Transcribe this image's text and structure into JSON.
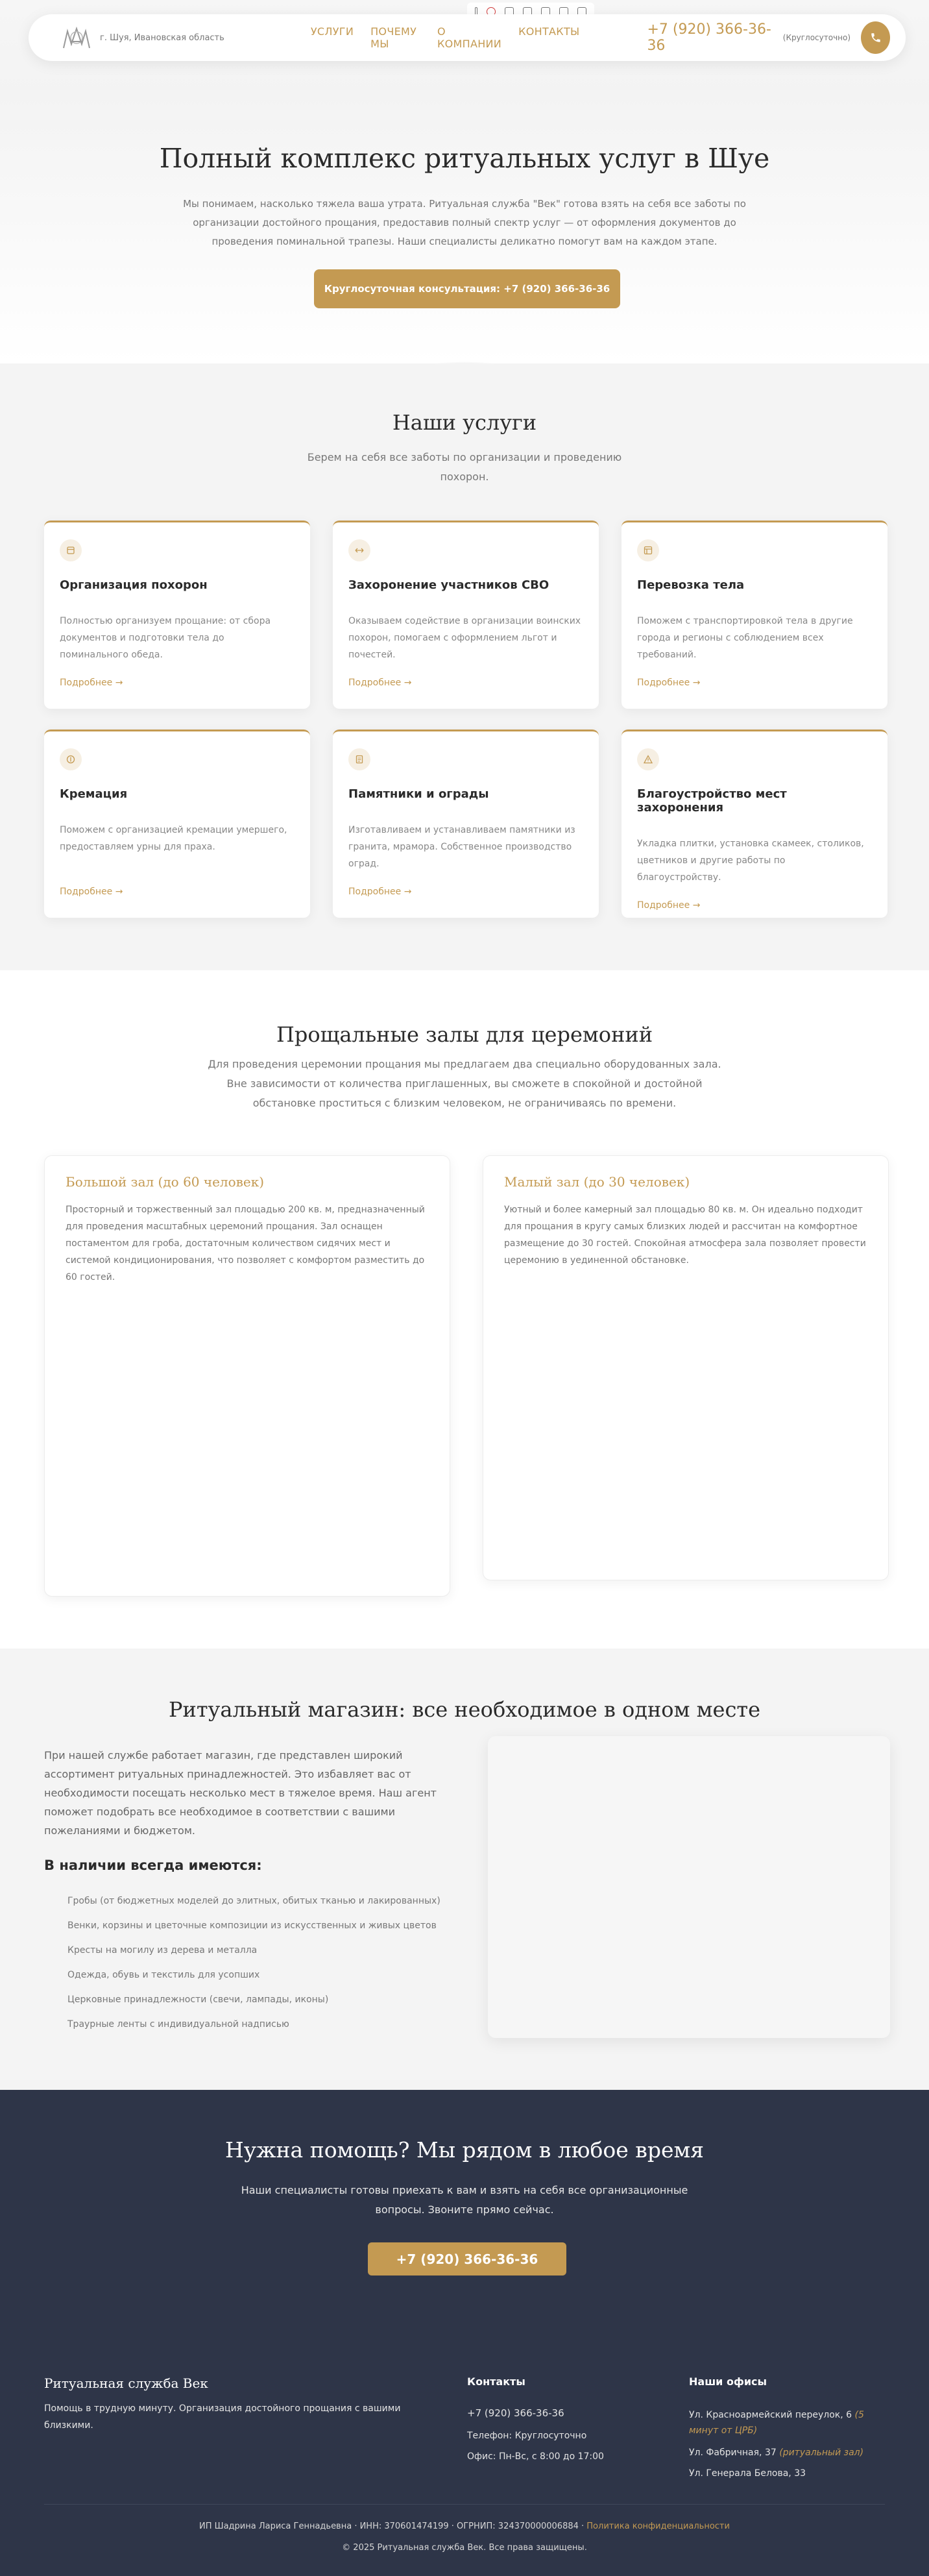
{
  "header": {
    "city": "г. Шуя, Ивановская область",
    "nav": [
      "УСЛУГИ",
      "ПОЧЕМУ МЫ",
      "О КОМПАНИИ",
      "КОНТАКТЫ"
    ],
    "phone": "+7 (920) 366-36-36",
    "phone_note": "(Круглосуточно)",
    "accent_color": "#c49a52"
  },
  "hero": {
    "title": "Полный комплекс ритуальных услуг в Шуе",
    "text": "Мы понимаем, насколько тяжела ваша утрата. Ритуальная служба \"Век\" готова взять на себя все заботы по организации достойного прощания, предоставив полный спектр услуг — от оформления документов до проведения поминальной трапезы. Наши специалисты деликатно помогут вам на каждом этапе.",
    "button": "Круглосуточная консультация: +7 (920) 366-36-36"
  },
  "services": {
    "title": "Наши услуги",
    "subtitle": "Берем на себя все заботы по организации и проведению похорон.",
    "more_label": "Подробнее →",
    "items": [
      {
        "title": "Организация похорон",
        "text": "Полностью организуем прощание: от сбора документов и подготовки тела до поминального обеда.",
        "icon": "coffin-icon"
      },
      {
        "title": "Захоронение участников СВО",
        "text": "Оказываем содействие в организации воинских похорон, помогаем с оформлением льгот и почестей.",
        "icon": "arrows-icon"
      },
      {
        "title": "Перевозка тела",
        "text": "Поможем с транспортировкой тела в другие города и регионы с соблюдением всех требований.",
        "icon": "transport-icon"
      },
      {
        "title": "Кремация",
        "text": "Поможем с организацией кремации умершего, предоставляем урны для праха.",
        "icon": "urn-icon"
      },
      {
        "title": "Памятники и ограды",
        "text": "Изготавливаем и устанавливаем памятники из гранита, мрамора. Собственное производство оград.",
        "icon": "monument-icon"
      },
      {
        "title": "Благоустройство мест захоронения",
        "text": "Укладка плитки, установка скамеек, столиков, цветников и другие работы по благоустройству.",
        "icon": "landscaping-icon"
      }
    ]
  },
  "halls": {
    "title": "Прощальные залы для церемоний",
    "subtitle": "Для проведения церемонии прощания мы предлагаем два специально оборудованных зала. Вне зависимости от количества приглашенных, вы сможете в спокойной и достойной обстановке проститься с близким человеком, не ограничиваясь по времени.",
    "big": {
      "title": "Большой зал (до 60 человек)",
      "text": "Просторный и торжественный зал площадью 200 кв. м, предназначенный для проведения масштабных церемоний прощания. Зал оснащен постаментом для гроба, достаточным количеством сидячих мест и системой кондиционирования, что позволяет с комфортом разместить до 60 гостей."
    },
    "small": {
      "title": "Малый зал (до 30 человек)",
      "text": "Уютный и более камерный зал площадью 80 кв. м. Он идеально подходит для прощания в кругу самых близких людей и рассчитан на комфортное размещение до 30 гостей. Спокойная атмосфера зала позволяет провести церемонию в уединенной обстановке."
    }
  },
  "shop": {
    "title": "Ритуальный магазин: все необходимое в одном месте",
    "text": "При нашей службе работает магазин, где представлен широкий ассортимент ритуальных принадлежностей. Это избавляет вас от необходимости посещать несколько мест в тяжелое время. Наш агент поможет подобрать все необходимое в соответствии с вашими пожеланиями и бюджетом.",
    "list_title": "В наличии всегда имеются:",
    "items": [
      "Гробы (от бюджетных моделей до элитных, обитых тканью и лакированных)",
      "Венки, корзины и цветочные композиции из искусственных и живых цветов",
      "Кресты на могилу из дерева и металла",
      "Одежда, обувь и текстиль для усопших",
      "Церковные принадлежности (свечи, лампады, иконы)",
      "Траурные ленты с индивидуальной надписью"
    ]
  },
  "cta": {
    "title": "Нужна помощь? Мы рядом в любое время",
    "text": "Наши специалисты готовы приехать к вам и взять на себя все организационные вопросы. Звоните прямо сейчас.",
    "button": "+7 (920) 366-36-36"
  },
  "footer": {
    "brand": "Ритуальная служба Век",
    "brand_text": "Помощь в трудную минуту. Организация достойного прощания с вашими близкими.",
    "contacts_title": "Контакты",
    "phone": "+7 (920) 366-36-36",
    "phone_hours": "Телефон: Круглосуточно",
    "office_hours": "Офис: Пн-Вс, с 8:00 до 17:00",
    "offices_title": "Наши офисы",
    "offices": [
      {
        "address": "Ул. Красноармейский переулок, 6",
        "note": "(5 минут от ЦРБ)"
      },
      {
        "address": "Ул. Фабричная, 37",
        "note": "(ритуальный зал)"
      },
      {
        "address": "Ул. Генерала Белова, 33",
        "note": ""
      }
    ],
    "legal": "ИП Шадрина Лариса Геннадьевна · ИНН: 370601474199 · ОГРНИП: 324370000006884 ·",
    "privacy": "Политика конфиденциальности",
    "copyright": "© 2025 Ритуальная служба Век. Все права защищены."
  }
}
